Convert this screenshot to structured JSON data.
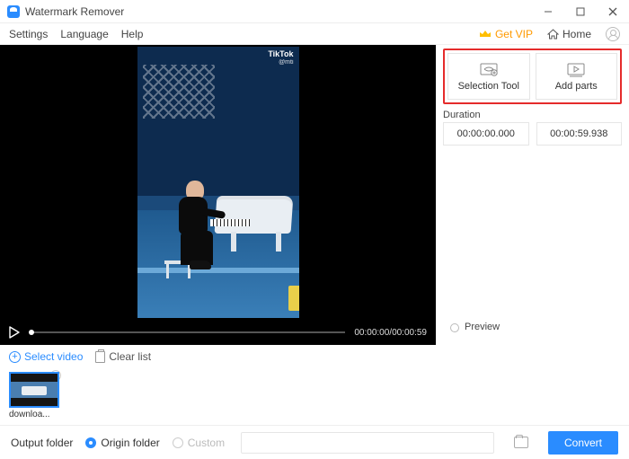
{
  "titlebar": {
    "app_title": "Watermark Remover"
  },
  "menubar": {
    "items": [
      "Settings",
      "Language",
      "Help"
    ],
    "get_vip": "Get VIP",
    "home": "Home"
  },
  "video": {
    "watermark_brand": "TikTok",
    "watermark_user": "@mti",
    "time_display": "00:00:00/00:00:59"
  },
  "side": {
    "tools": {
      "selection": "Selection Tool",
      "addparts": "Add parts"
    },
    "duration_label": "Duration",
    "duration_start": "00:00:00.000",
    "duration_end": "00:00:59.938",
    "preview": "Preview"
  },
  "selectrow": {
    "select_video": "Select video",
    "clear_list": "Clear list"
  },
  "thumb": {
    "filename": "downloa..."
  },
  "footer": {
    "output_folder": "Output folder",
    "origin_folder": "Origin folder",
    "custom": "Custom",
    "convert": "Convert"
  }
}
